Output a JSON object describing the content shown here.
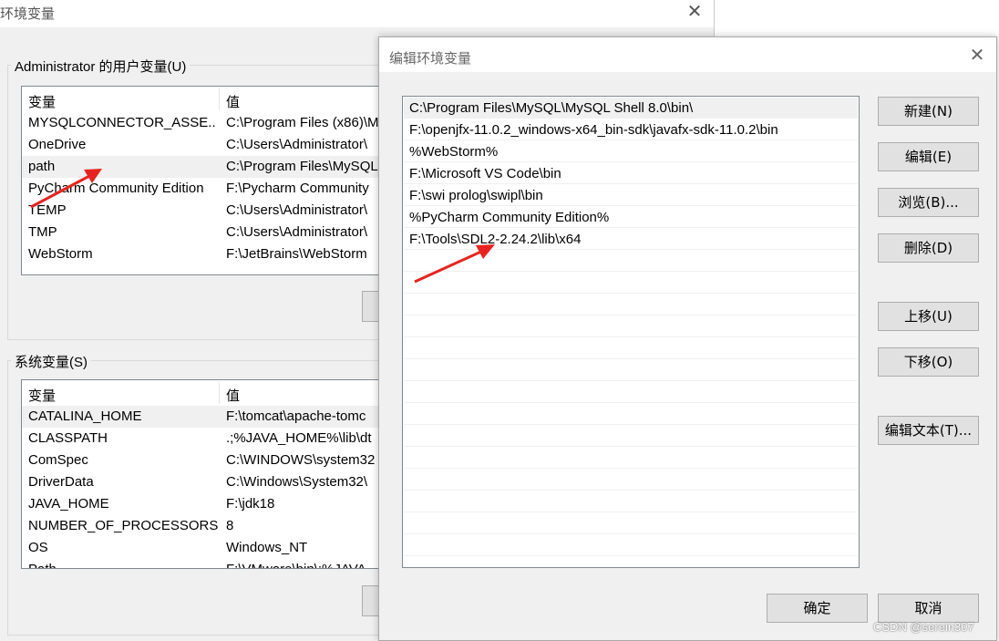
{
  "background_window": {
    "title": "环境变量",
    "user_vars": {
      "label": "Administrator 的用户变量(U)",
      "headers": [
        "变量",
        "值"
      ],
      "rows": [
        {
          "name": "MYSQLCONNECTOR_ASSE...",
          "value": "C:\\Program Files (x86)\\M"
        },
        {
          "name": "OneDrive",
          "value": "C:\\Users\\Administrator\\"
        },
        {
          "name": "path",
          "value": "C:\\Program Files\\MySQL"
        },
        {
          "name": "PyCharm Community Edition",
          "value": "F:\\Pycharm Community"
        },
        {
          "name": "TEMP",
          "value": "C:\\Users\\Administrator\\"
        },
        {
          "name": "TMP",
          "value": "C:\\Users\\Administrator\\"
        },
        {
          "name": "WebStorm",
          "value": "F:\\JetBrains\\WebStorm"
        }
      ]
    },
    "system_vars": {
      "label": "系统变量(S)",
      "headers": [
        "变量",
        "值"
      ],
      "rows": [
        {
          "name": "CATALINA_HOME",
          "value": "F:\\tomcat\\apache-tomc"
        },
        {
          "name": "CLASSPATH",
          "value": ".;%JAVA_HOME%\\lib\\dt"
        },
        {
          "name": "ComSpec",
          "value": "C:\\WINDOWS\\system32"
        },
        {
          "name": "DriverData",
          "value": "C:\\Windows\\System32\\"
        },
        {
          "name": "JAVA_HOME",
          "value": "F:\\jdk18"
        },
        {
          "name": "NUMBER_OF_PROCESSORS",
          "value": "8"
        },
        {
          "name": "OS",
          "value": "Windows_NT"
        },
        {
          "name": "Path",
          "value": "F:\\VMware\\bin\\;%JAVA"
        }
      ]
    }
  },
  "dialog": {
    "title": "编辑环境变量",
    "entries": [
      "C:\\Program Files\\MySQL\\MySQL Shell 8.0\\bin\\",
      "F:\\openjfx-11.0.2_windows-x64_bin-sdk\\javafx-sdk-11.0.2\\bin",
      "%WebStorm%",
      "F:\\Microsoft VS Code\\bin",
      "F:\\swi prolog\\swipl\\bin",
      "%PyCharm Community Edition%",
      "F:\\Tools\\SDL2-2.24.2\\lib\\x64"
    ],
    "buttons": {
      "new": "新建(N)",
      "edit": "编辑(E)",
      "browse": "浏览(B)...",
      "delete": "删除(D)",
      "move_up": "上移(U)",
      "move_down": "下移(O)",
      "edit_text": "编辑文本(T)...",
      "ok": "确定",
      "cancel": "取消"
    }
  },
  "watermark": "CSDN @serein307",
  "colors": {
    "annotation_arrow": "#e8231f",
    "selection": "#f0f0f0"
  }
}
